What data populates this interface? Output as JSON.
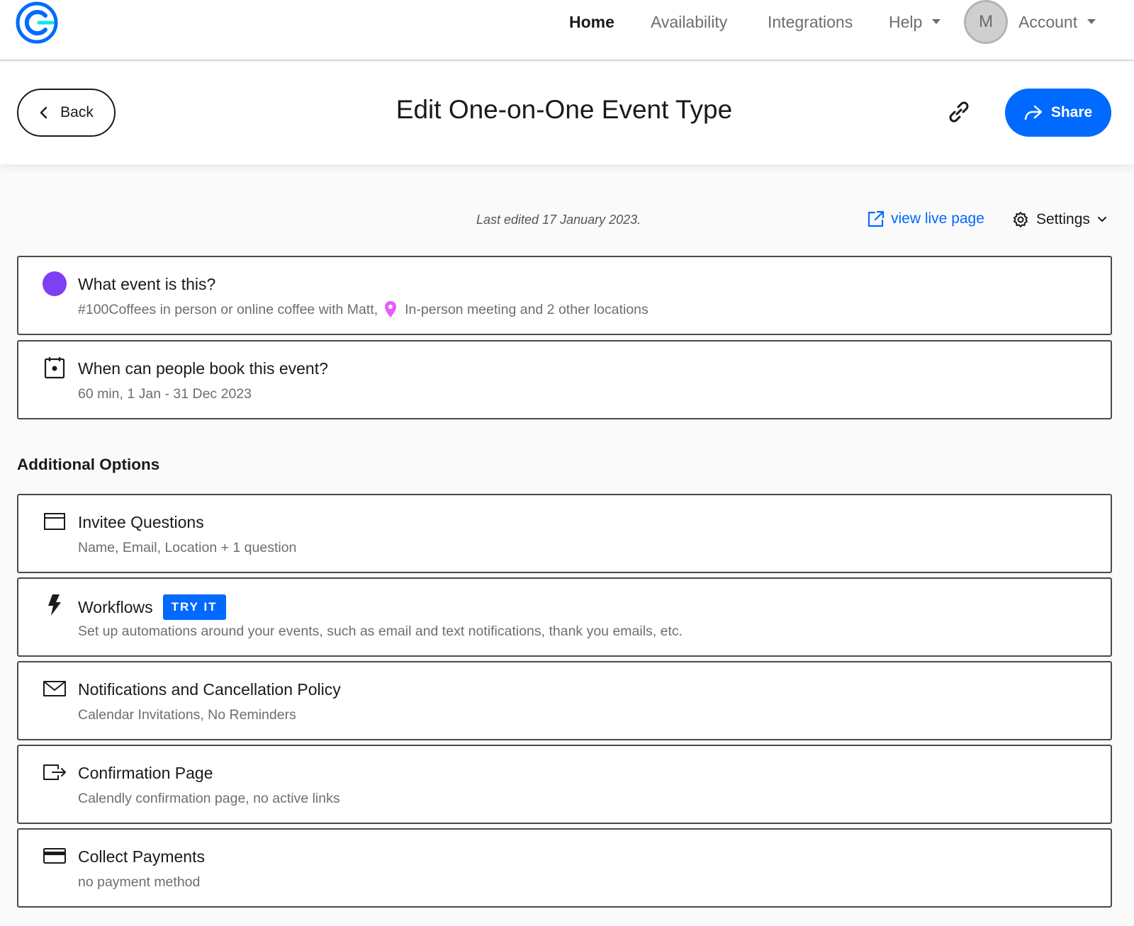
{
  "nav": {
    "items": [
      {
        "label": "Home",
        "active": true
      },
      {
        "label": "Availability"
      },
      {
        "label": "Integrations"
      },
      {
        "label": "Help"
      }
    ],
    "avatar_initial": "M",
    "account_label": "Account"
  },
  "header": {
    "back_label": "Back",
    "title": "Edit One-on-One Event Type",
    "share_label": "Share"
  },
  "meta": {
    "last_edited": "Last edited 17 January 2023.",
    "view_live_label": "view live page",
    "settings_label": "Settings"
  },
  "event_cards": [
    {
      "title": "What event is this?",
      "sub_prefix": "#100Coffees in person or online coffee with Matt,",
      "sub_location": "In-person meeting and 2 other locations",
      "icon": "purple-dot",
      "pin_color": "#e55cff"
    },
    {
      "title": "When can people book this event?",
      "sub": "60 min, 1 Jan - 31 Dec 2023",
      "icon": "calendar-icon"
    }
  ],
  "additional": {
    "heading": "Additional Options",
    "cards": [
      {
        "title": "Invitee Questions",
        "sub": "Name, Email, Location + 1 question",
        "icon": "form-icon"
      },
      {
        "title": "Workflows",
        "badge": "TRY IT",
        "sub": "Set up automations around your events, such as email and text notifications, thank you emails, etc.",
        "icon": "lightning-icon"
      },
      {
        "title": "Notifications and Cancellation Policy",
        "sub": "Calendar Invitations, No Reminders",
        "icon": "envelope-icon"
      },
      {
        "title": "Confirmation Page",
        "sub": "Calendly confirmation page, no active links",
        "icon": "exit-icon"
      },
      {
        "title": "Collect Payments",
        "sub": "no payment method",
        "icon": "credit-card-icon"
      }
    ]
  },
  "colors": {
    "accent": "#0069ff",
    "event_color": "#7f3ff2"
  }
}
